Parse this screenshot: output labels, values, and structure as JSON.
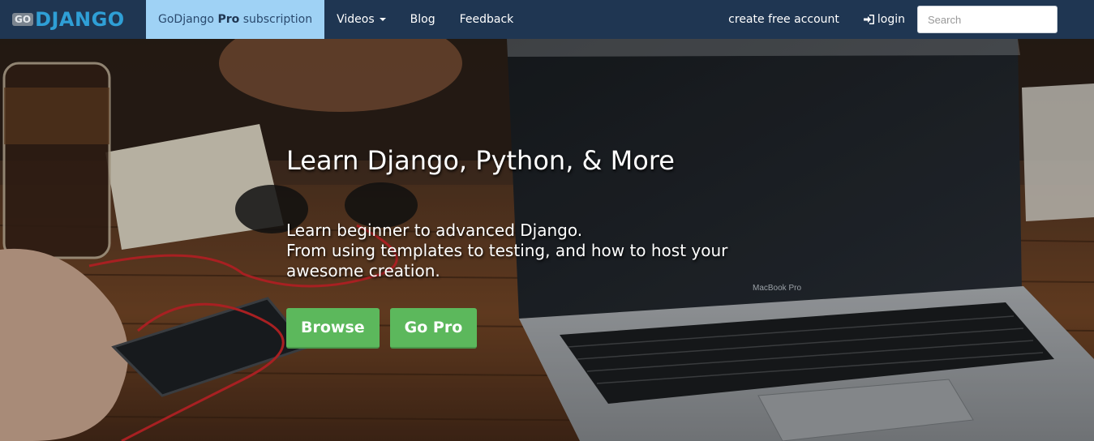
{
  "brand": {
    "badge": "GO",
    "name": "DJANGO"
  },
  "nav": {
    "pro": {
      "prefix": "GoDjango ",
      "bold": "Pro",
      "suffix": " subscription"
    },
    "videos": "Videos",
    "blog": "Blog",
    "feedback": "Feedback",
    "create_account": "create free account",
    "login": "login",
    "search_placeholder": "Search"
  },
  "hero": {
    "title": "Learn Django, Python, & More",
    "subtitle_lines": [
      "Learn beginner to advanced Django.",
      "From using templates to testing, and how to host your",
      "awesome creation."
    ],
    "browse": "Browse",
    "go_pro": "Go Pro",
    "laptop_label": "MacBook Pro"
  },
  "colors": {
    "navbar": "#1f3652",
    "pro_tab": "#9fd2f5",
    "brand_blue": "#2f9fd6",
    "button_green": "#5cb85c"
  },
  "icons": {
    "login": "login-icon",
    "caret": "chevron-down-icon"
  }
}
